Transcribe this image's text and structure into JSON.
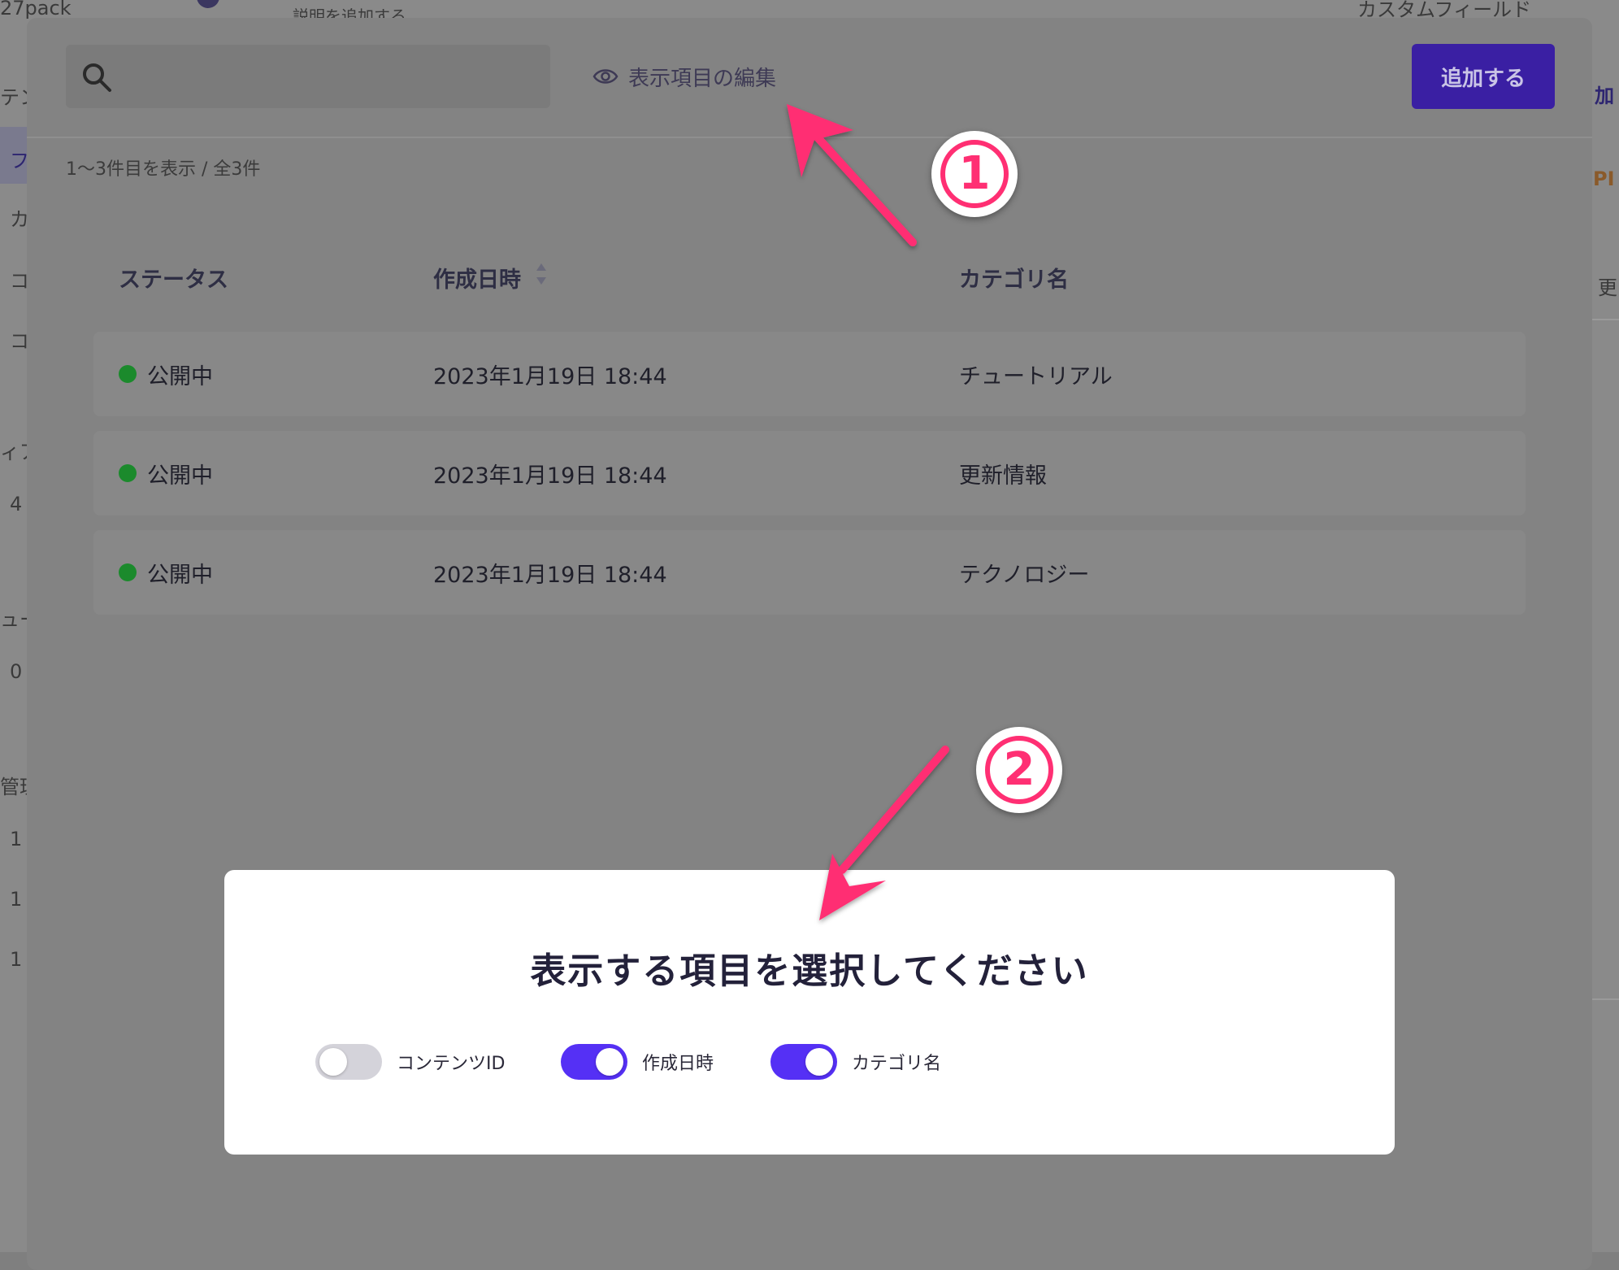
{
  "background": {
    "top_partial_left": "27pack",
    "top_partial_mid": "説明を追加する",
    "top_partial_right": "カスタムフィールド",
    "side_fragments": [
      "テン",
      "フ",
      "カ",
      "コ",
      "コ",
      "ィア",
      "4",
      "ュー",
      "0",
      "管理",
      "1",
      "1",
      "1"
    ],
    "right_fragments": [
      "加",
      "PI",
      "更"
    ]
  },
  "modal": {
    "search": {
      "placeholder": "",
      "icon": "search-icon"
    },
    "edit_display_label": "表示項目の編集",
    "edit_display_icon": "eye-icon",
    "add_button_label": "追加する",
    "count_text": "1〜3件目を表示 / 全3件",
    "columns": [
      "ステータス",
      "作成日時",
      "カテゴリ名"
    ],
    "sort_icon": "sort-icon",
    "rows": [
      {
        "status": "公開中",
        "created": "2023年1月19日 18:44",
        "category": "チュートリアル"
      },
      {
        "status": "公開中",
        "created": "2023年1月19日 18:44",
        "category": "更新情報"
      },
      {
        "status": "公開中",
        "created": "2023年1月19日 18:44",
        "category": "テクノロジー"
      }
    ],
    "status_color": "#1b8a2c",
    "accent_color": "#3a1fa3"
  },
  "popup": {
    "title": "表示する項目を選択してください",
    "toggles": [
      {
        "label": "コンテンツID",
        "on": false
      },
      {
        "label": "作成日時",
        "on": true
      },
      {
        "label": "カテゴリ名",
        "on": true
      }
    ],
    "toggle_on_color": "#5530f5",
    "toggle_off_color": "#d4d3da"
  },
  "annotations": {
    "badge_1": "1",
    "badge_2": "2",
    "arrow_color": "#ff2f73"
  }
}
